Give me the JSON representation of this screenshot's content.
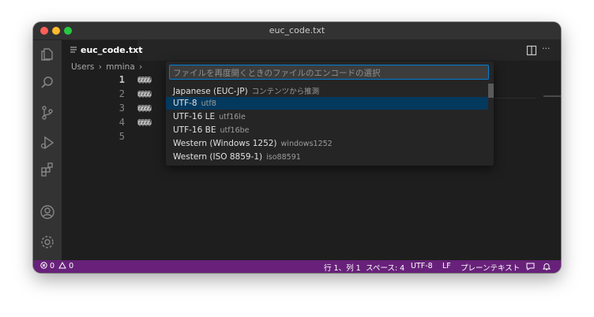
{
  "window": {
    "title": "euc_code.txt"
  },
  "tab": {
    "label": "euc_code.txt",
    "close": "›"
  },
  "breadcrumb": {
    "items": [
      "Users",
      "›",
      "mmina",
      "›"
    ]
  },
  "editor": {
    "lines": [
      {
        "number": "1",
        "text": "����"
      },
      {
        "number": "2",
        "text": "����"
      },
      {
        "number": "3",
        "text": "����"
      },
      {
        "number": "4",
        "text": "����"
      },
      {
        "number": "5",
        "text": ""
      }
    ]
  },
  "quick_pick": {
    "placeholder": "ファイルを再度開くときのファイルのエンコードの選択",
    "items": [
      {
        "label": "Japanese (EUC-JP)",
        "description": "コンテンツから推測",
        "selected": false
      },
      {
        "label": "UTF-8",
        "description": "utf8",
        "selected": true
      },
      {
        "label": "UTF-16 LE",
        "description": "utf16le",
        "selected": false
      },
      {
        "label": "UTF-16 BE",
        "description": "utf16be",
        "selected": false
      },
      {
        "label": "Western (Windows 1252)",
        "description": "windows1252",
        "selected": false
      },
      {
        "label": "Western (ISO 8859-1)",
        "description": "iso88591",
        "selected": false
      }
    ]
  },
  "statusbar": {
    "errors": "0",
    "warnings": "0",
    "position": "行 1、列 1",
    "spaces": "スペース: 4",
    "encoding": "UTF-8",
    "eol": "LF",
    "language": "プレーンテキスト"
  },
  "toolbar": {
    "more": "···"
  },
  "colors": {
    "statusbar_bg": "#68217a",
    "selection_bg": "#04395e",
    "focus_border": "#007fd4",
    "editor_bg": "#1e1e1e"
  }
}
